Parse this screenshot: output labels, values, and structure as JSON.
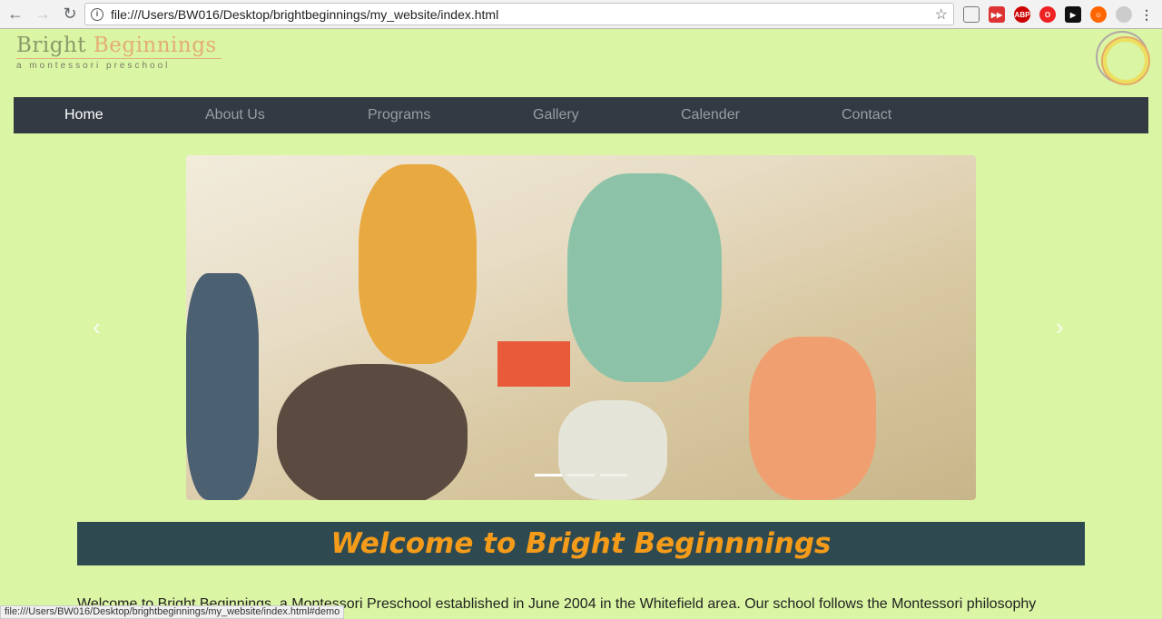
{
  "browser": {
    "url": "file:///Users/BW016/Desktop/brightbeginnings/my_website/index.html",
    "status_url": "file:///Users/BW016/Desktop/brightbeginnings/my_website/index.html#demo",
    "ext_abp": "ABP"
  },
  "logo": {
    "word1": "Bright",
    "word2": "Beginnings",
    "tagline": "a montessori preschool"
  },
  "nav": [
    {
      "label": "Home"
    },
    {
      "label": "About Us"
    },
    {
      "label": "Programs"
    },
    {
      "label": "Gallery"
    },
    {
      "label": "Calender"
    },
    {
      "label": "Contact"
    }
  ],
  "carousel": {
    "slides": 3,
    "active": 0,
    "prev": "‹",
    "next": "›"
  },
  "welcome": {
    "title": "Welcome to Bright Beginnnings"
  },
  "intro": "Welcome to Bright Beginnings, a Montessori Preschool established in June 2004 in the Whitefield area. Our school follows the Montessori philosophy"
}
